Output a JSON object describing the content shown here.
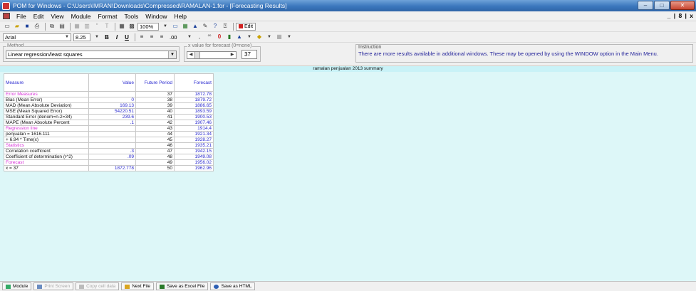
{
  "window": {
    "title": "POM for Windows - C:\\Users\\IMRAN\\Downloads\\Compressed\\RAMALAN-1.for - [Forecasting Results]",
    "minimize": "–",
    "maximize": "□",
    "close": "✕"
  },
  "menu": {
    "items": [
      "File",
      "Edit",
      "View",
      "Module",
      "Format",
      "Tools",
      "Window",
      "Help"
    ],
    "mdi_controls": "_ | 8 | x"
  },
  "toolbar": {
    "zoom": "100%",
    "edit_label": "Edit",
    "font_name": "Arial",
    "font_size": "8.25",
    "decimals": ".00"
  },
  "method": {
    "legend": "Method",
    "selected": "Linear regression/least squares"
  },
  "forecast_input": {
    "legend": "x value for forecast (0=none)",
    "value": "37"
  },
  "instruction": {
    "label": "Instruction",
    "text": "There are more results available in additional windows. These may be opened by using the WINDOW option in the Main Menu."
  },
  "summary_title": "ramalan penjualan 2013 summary",
  "table": {
    "headers": {
      "measure": "Measure",
      "value": "Value",
      "period": "Future Period",
      "forecast": "Forecast"
    },
    "rows": [
      {
        "measure": "Error Measures",
        "value": "",
        "period": "37",
        "forecast": "1872.78",
        "section": true
      },
      {
        "measure": "Bias (Mean Error)",
        "value": "0",
        "period": "38",
        "forecast": "1879.72",
        "section": false
      },
      {
        "measure": "MAD (Mean Absolute Deviation)",
        "value": "169.13",
        "period": "39",
        "forecast": "1886.65",
        "section": false
      },
      {
        "measure": "MSE (Mean Squared Error)",
        "value": "54220.51",
        "period": "40",
        "forecast": "1893.59",
        "section": false
      },
      {
        "measure": "Standard Error (denom=n-2=34)",
        "value": "239.6",
        "period": "41",
        "forecast": "1900.53",
        "section": false
      },
      {
        "measure": "MAPE (Mean Absolute Percent",
        "value": ".1",
        "period": "42",
        "forecast": "1907.46",
        "section": false
      },
      {
        "measure": "Regression line",
        "value": "",
        "period": "43",
        "forecast": "1914.4",
        "section": true
      },
      {
        "measure": "penjualan = 1616.111",
        "value": "",
        "period": "44",
        "forecast": "1921.34",
        "section": false
      },
      {
        "measure": " + 6.94 * Time(x)",
        "value": "",
        "period": "45",
        "forecast": "1928.27",
        "section": false
      },
      {
        "measure": "Statistics",
        "value": "",
        "period": "46",
        "forecast": "1935.21",
        "section": true
      },
      {
        "measure": "Correlation coefficient",
        "value": ".3",
        "period": "47",
        "forecast": "1942.15",
        "section": false
      },
      {
        "measure": "Coefficient of determination (r^2)",
        "value": ".09",
        "period": "48",
        "forecast": "1949.08",
        "section": false
      },
      {
        "measure": "Forecast",
        "value": "",
        "period": "49",
        "forecast": "1956.02",
        "section": true
      },
      {
        "measure": "x = 37",
        "value": "1872.778",
        "period": "50",
        "forecast": "1962.96",
        "section": false
      }
    ]
  },
  "bottom_buttons": [
    {
      "label": "Module",
      "icon": "module-icon",
      "disabled": false
    },
    {
      "label": "Print Screen",
      "icon": "print-screen-icon",
      "disabled": true
    },
    {
      "label": "Copy cell data",
      "icon": "copy-icon",
      "disabled": true
    },
    {
      "label": "Next File",
      "icon": "next-file-icon",
      "disabled": false
    },
    {
      "label": "Save as Excel File",
      "icon": "excel-icon",
      "disabled": false
    },
    {
      "label": "Save as HTML",
      "icon": "html-icon",
      "disabled": false
    }
  ],
  "colors": {
    "grid_background": "#ddf7f8",
    "section_label": "#d832d8",
    "value_text": "#2b2bd0",
    "titlebar": "#3b77bd"
  }
}
